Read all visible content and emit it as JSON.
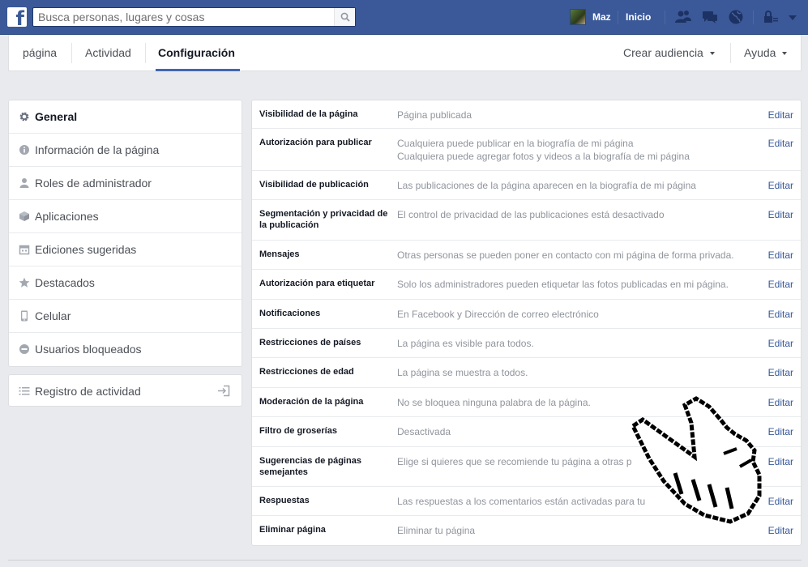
{
  "topbar": {
    "search_placeholder": "Busca personas, lugares y cosas",
    "user_name": "Maz",
    "home_label": "Inicio"
  },
  "tabs": {
    "items": [
      {
        "label": "página",
        "active": false
      },
      {
        "label": "Actividad",
        "active": false
      },
      {
        "label": "Configuración",
        "active": true
      }
    ],
    "create_audience": "Crear audiencia",
    "help": "Ayuda"
  },
  "sidebar": {
    "items": [
      {
        "label": "General",
        "icon": "gear-icon",
        "active": true
      },
      {
        "label": "Información de la página",
        "icon": "info-icon",
        "active": false
      },
      {
        "label": "Roles de administrador",
        "icon": "person-icon",
        "active": false
      },
      {
        "label": "Aplicaciones",
        "icon": "cube-icon",
        "active": false
      },
      {
        "label": "Ediciones sugeridas",
        "icon": "calendar-icon",
        "active": false
      },
      {
        "label": "Destacados",
        "icon": "star-icon",
        "active": false
      },
      {
        "label": "Celular",
        "icon": "phone-icon",
        "active": false
      },
      {
        "label": "Usuarios bloqueados",
        "icon": "block-icon",
        "active": false
      }
    ],
    "activity_log": "Registro de actividad"
  },
  "settings": {
    "edit_label": "Editar",
    "rows": [
      {
        "name": "Visibilidad de la página",
        "value": "Página publicada"
      },
      {
        "name": "Autorización para publicar",
        "value": "Cualquiera puede publicar en la biografía de mi página\nCualquiera puede agregar fotos y videos a la biografía de mi página"
      },
      {
        "name": "Visibilidad de publicación",
        "value": "Las publicaciones de la página aparecen en la biografía de mi página"
      },
      {
        "name": "Segmentación y privacidad de la publicación",
        "value": "El control de privacidad de las publicaciones está desactivado"
      },
      {
        "name": "Mensajes",
        "value": "Otras personas se pueden poner en contacto con mi página de forma privada."
      },
      {
        "name": "Autorización para etiquetar",
        "value": "Solo los administradores pueden etiquetar las fotos publicadas en mi página."
      },
      {
        "name": "Notificaciones",
        "value": "En Facebook y Dirección de correo electrónico"
      },
      {
        "name": "Restricciones de países",
        "value": "La página es visible para todos."
      },
      {
        "name": "Restricciones de edad",
        "value": "La página se muestra a todos."
      },
      {
        "name": "Moderación de la página",
        "value": "No se bloquea ninguna palabra de la página."
      },
      {
        "name": "Filtro de groserías",
        "value": "Desactivada"
      },
      {
        "name": "Sugerencias de páginas semejantes",
        "value": "Elige si quieres que se recomiende tu página a otras p"
      },
      {
        "name": "Respuestas",
        "value": "Las respuestas a los comentarios están activadas para tu"
      },
      {
        "name": "Eliminar página",
        "value": "Eliminar tu página"
      }
    ]
  },
  "colors": {
    "brand_blue": "#3b5998",
    "link_blue": "#365899",
    "active_tab": "#4267b2"
  }
}
